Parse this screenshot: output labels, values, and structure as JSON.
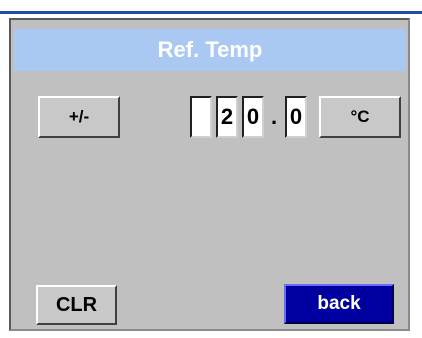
{
  "header": {
    "title": "Ref. Temp"
  },
  "controls": {
    "sign_toggle_label": "+/-",
    "unit_label": "°C",
    "clear_label": "CLR",
    "back_label": "back"
  },
  "value_entry": {
    "digits": [
      "",
      "2",
      "0",
      "0"
    ],
    "decimal_separator": ".",
    "value": 20.0
  },
  "colors": {
    "title_bar": "#a9c8f2",
    "panel": "#c0c0c0",
    "back_button": "#0000a0",
    "top_rule": "#1f4fa0"
  }
}
